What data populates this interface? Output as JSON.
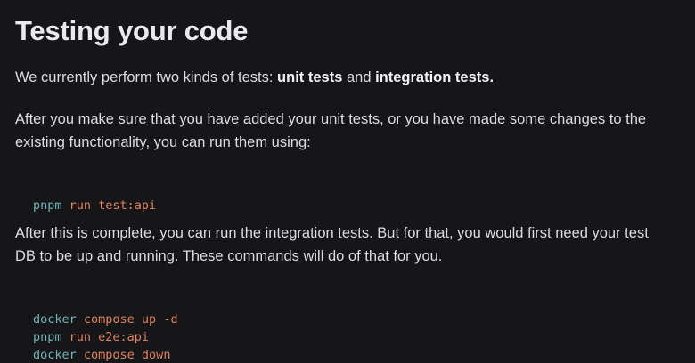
{
  "heading": "Testing your code",
  "intro": {
    "prefix": "We currently perform two kinds of tests: ",
    "bold1": "unit tests",
    "mid": " and ",
    "bold2": "integration tests."
  },
  "para_unit_line1": "After you make sure that you have added your unit tests, or you have made some changes to the",
  "para_unit_line2": "existing functionality, you can run them using:",
  "code_unit": [
    {
      "cmd": "pnpm",
      "args": " run test:api"
    }
  ],
  "para_integration_line1": "After this is complete, you can run the integration tests. But for that, you would first need your test",
  "para_integration_line2": "DB to be up and running. These commands will do of that for you.",
  "code_integration": [
    {
      "cmd": "docker",
      "args": " compose up -d"
    },
    {
      "cmd": "pnpm",
      "args": " run e2e:api"
    },
    {
      "cmd": "docker",
      "args": " compose down"
    }
  ],
  "colors": {
    "background": "#161618",
    "command": "#6fb3b8",
    "argument": "#e0825f"
  }
}
